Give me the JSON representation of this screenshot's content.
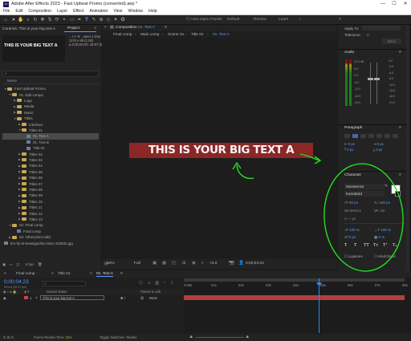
{
  "window": {
    "title": "Adobe After Effects 2023 - Fast Upbeat Promo (converted).aep *",
    "logo": "Ae",
    "minimize": "—",
    "maximize": "☐",
    "close": "✕"
  },
  "menu": [
    "File",
    "Edit",
    "Composition",
    "Layer",
    "Effect",
    "Animation",
    "View",
    "Window",
    "Help"
  ],
  "toolbar": {
    "auto_open": "Auto-Open Panels",
    "workspaces": [
      "Default",
      "Review",
      "Learn"
    ]
  },
  "effect_controls": {
    "tab": "Controls: This is your big text A",
    "preview_text": "THIS IS YOUR BIG TEXT A"
  },
  "project": {
    "tab": "Project",
    "info_lines": [
      "…t A ▼ , used 1 time",
      "1176 x 88 (1.00)",
      "Δ 0;00;00;00, 29.97 fps"
    ],
    "search_placeholder": "",
    "column_name": "Name",
    "items": [
      {
        "label": "Fast Upbeat Promo",
        "depth": 0,
        "kind": "folder",
        "open": true
      },
      {
        "label": "01. Edit comps",
        "depth": 1,
        "kind": "folder",
        "open": true
      },
      {
        "label": "Logo",
        "depth": 2,
        "kind": "folder"
      },
      {
        "label": "Media",
        "depth": 2,
        "kind": "folder"
      },
      {
        "label": "Music",
        "depth": 2,
        "kind": "folder"
      },
      {
        "label": "Titles",
        "depth": 2,
        "kind": "folder",
        "open": true
      },
      {
        "label": "Interface",
        "depth": 3,
        "kind": "folder"
      },
      {
        "label": "Titles 01",
        "depth": 3,
        "kind": "folder",
        "open": true
      },
      {
        "label": "01. Text A",
        "depth": 4,
        "kind": "comp",
        "selected": true
      },
      {
        "label": "01. Text B",
        "depth": 4,
        "kind": "comp"
      },
      {
        "label": "Title 01",
        "depth": 4,
        "kind": "comp"
      },
      {
        "label": "Titles 02",
        "depth": 3,
        "kind": "folder"
      },
      {
        "label": "Titles 03",
        "depth": 3,
        "kind": "folder"
      },
      {
        "label": "Titles 04",
        "depth": 3,
        "kind": "folder"
      },
      {
        "label": "Titles 05",
        "depth": 3,
        "kind": "folder"
      },
      {
        "label": "Titles 06",
        "depth": 3,
        "kind": "folder"
      },
      {
        "label": "Titles 07",
        "depth": 3,
        "kind": "folder"
      },
      {
        "label": "Titles 08",
        "depth": 3,
        "kind": "folder"
      },
      {
        "label": "Titles 09",
        "depth": 3,
        "kind": "folder"
      },
      {
        "label": "Titles 10",
        "depth": 3,
        "kind": "folder"
      },
      {
        "label": "Titles 11",
        "depth": 3,
        "kind": "folder"
      },
      {
        "label": "Titles 12",
        "depth": 3,
        "kind": "folder"
      },
      {
        "label": "Titles 13",
        "depth": 3,
        "kind": "folder"
      },
      {
        "label": "02. Final comp",
        "depth": 1,
        "kind": "folder",
        "open": true
      },
      {
        "label": "Final comp",
        "depth": 2,
        "kind": "comp"
      },
      {
        "label": "03. Other(dont edit)",
        "depth": 1,
        "kind": "folder"
      },
      {
        "label": "tim-ful-et-kewsgachlor-lelor-433832.jpg",
        "depth": 0,
        "kind": "image"
      }
    ],
    "bpc": "8 bpc"
  },
  "composition": {
    "tab_prefix": "Composition",
    "tab_name": "01. Text A",
    "breadcrumbs": [
      "Final comp",
      "Main comp",
      "Scene 01",
      "Title 01",
      "01. Text A"
    ],
    "canvas_text": "THIS IS YOUR BIG TEXT A",
    "zoom": "50%",
    "resolution": "Full",
    "exposure": "+0.0",
    "timecode": "0;00;04;23"
  },
  "right_panel": {
    "apply_to": "Apply To:",
    "tolerance": "Tolerance:",
    "tolerance_value": "2",
    "bake_btn": "Bake",
    "audio_tab": "Audio",
    "db_scale": [
      "12.0 dB",
      "6.0",
      "0.0",
      "-6.0",
      "-12.0",
      "-18.0",
      "-24.0"
    ],
    "db_scale_right": [
      "0.0",
      "-3.0",
      "-6.0",
      "-9.0",
      "-12.0",
      "-15.0",
      "-18.0",
      "-21.0"
    ],
    "paragraph_tab": "Paragraph",
    "para_values": [
      "0 px",
      "0 px",
      "0 px",
      "0 px",
      "0 px"
    ]
  },
  "character": {
    "tab": "Character",
    "font": "Montserrat",
    "style": "ExtraBold",
    "size": "80 px",
    "leading": "100 px",
    "kerning": "Metrics",
    "tracking": "-10",
    "stroke": "— px",
    "vscale": "100 %",
    "hscale": "100 %",
    "baseline": "0 px",
    "tsume": "0 %",
    "style_buttons": [
      "T",
      "T",
      "TT",
      "Tт",
      "T¹",
      "T₁"
    ],
    "ligatures": "Ligatures",
    "hindi_digits": "Hindi Digits",
    "colors": {
      "fill": "#ffffff",
      "stroke": "#000000"
    }
  },
  "timeline": {
    "tabs": [
      "Final comp",
      "Title 01",
      "01. Text A"
    ],
    "timecode": "0;00;04;23",
    "frame_info": "00143 (29.97 fps)",
    "search_placeholder": "",
    "col_source": "Source Name",
    "col_parent": "Parent & Link",
    "layer_num": "1",
    "layer_name": "This is your big text A",
    "layer_parent": "None",
    "ruler": [
      "0:00s",
      "01s",
      "02s",
      "03s",
      "04s",
      "05s",
      "06s",
      "07s",
      "08s"
    ],
    "footer_render": "Frame Render Time:",
    "footer_render_value": "2ms",
    "footer_toggle": "Toggle Switches / Modes"
  },
  "colors": {
    "text_highlight": "#8b2727",
    "annotation": "#22e022",
    "ae_blue": "#2d8ceb",
    "layer_bar": "#b33e3e"
  }
}
